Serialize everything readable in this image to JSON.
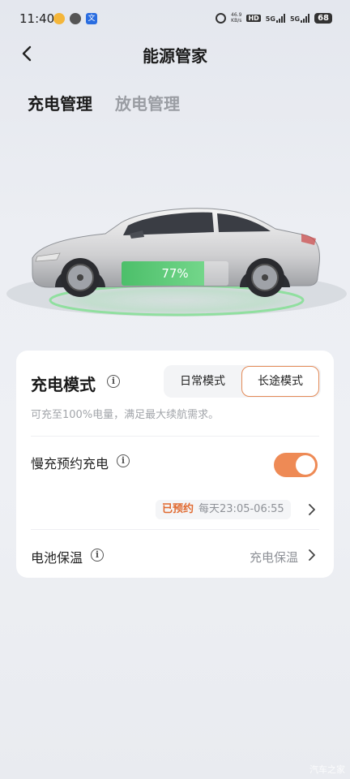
{
  "status_bar": {
    "time": "11:40",
    "translate_glyph": "文",
    "net_speed_value": "46.9",
    "net_speed_unit": "KB/s",
    "hd_label": "HD",
    "signal1_label": "5G",
    "signal2_label": "5G",
    "battery_level": "68"
  },
  "header": {
    "title": "能源管家",
    "back_icon": "chevron-left-icon"
  },
  "tabs": [
    {
      "label": "充电管理",
      "active": true
    },
    {
      "label": "放电管理",
      "active": false
    }
  ],
  "vehicle": {
    "charge_percent_label": "77%",
    "charge_level": 0.77,
    "battery_color": "#5cc977"
  },
  "charge_mode": {
    "title": "充电模式",
    "info_glyph": "i",
    "options": [
      "日常模式",
      "长途模式"
    ],
    "selected": "长途模式",
    "description": "可充至100%电量，满足最大续航需求。",
    "accent_color": "#e38a57"
  },
  "slow_charge": {
    "label": "慢充预约充电",
    "info_glyph": "i",
    "enabled": true,
    "toggle_color": "#ee8a55",
    "schedule_badge": "已预约",
    "schedule_time": "每天23:05-06:55"
  },
  "battery_heating": {
    "label": "电池保温",
    "info_glyph": "i",
    "value": "充电保温"
  },
  "watermark": "汽车之家"
}
